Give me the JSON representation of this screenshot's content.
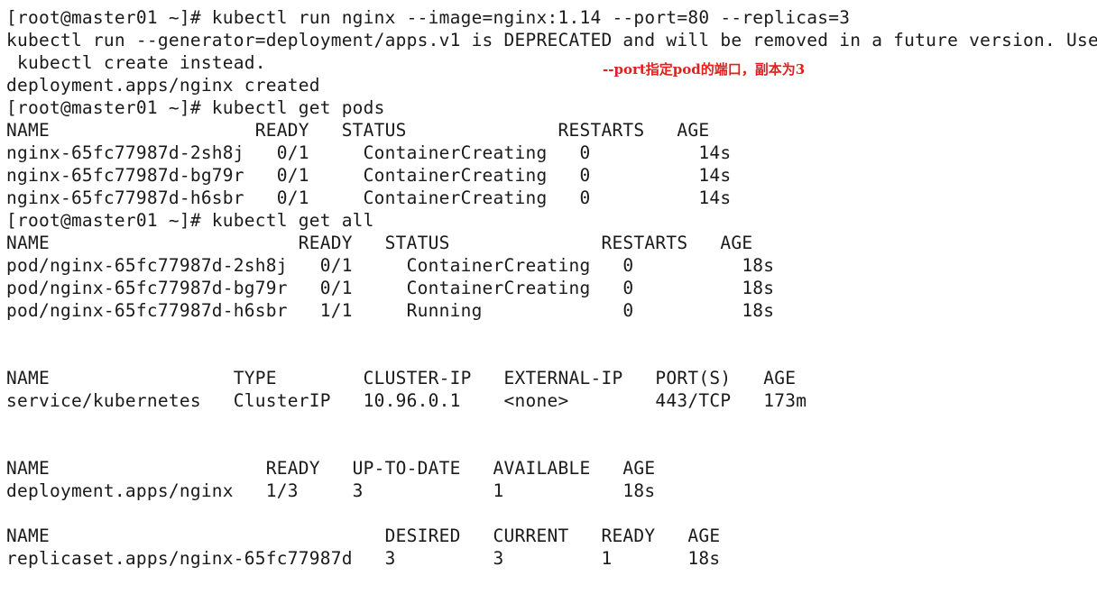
{
  "terminal": {
    "annotation": "--port指定pod的端口，副本为3",
    "lines": [
      "[root@master01 ~]# kubectl run nginx --image=nginx:1.14 --port=80 --replicas=3",
      "kubectl run --generator=deployment/apps.v1 is DEPRECATED and will be removed in a future version. Use",
      " kubectl create instead.",
      "deployment.apps/nginx created",
      "[root@master01 ~]# kubectl get pods",
      "NAME                   READY   STATUS              RESTARTS   AGE",
      "nginx-65fc77987d-2sh8j   0/1     ContainerCreating   0          14s",
      "nginx-65fc77987d-bg79r   0/1     ContainerCreating   0          14s",
      "nginx-65fc77987d-h6sbr   0/1     ContainerCreating   0          14s",
      "[root@master01 ~]# kubectl get all",
      "NAME                       READY   STATUS              RESTARTS   AGE",
      "pod/nginx-65fc77987d-2sh8j   0/1     ContainerCreating   0          18s",
      "pod/nginx-65fc77987d-bg79r   0/1     ContainerCreating   0          18s",
      "pod/nginx-65fc77987d-h6sbr   1/1     Running             0          18s",
      "",
      "",
      "NAME                 TYPE        CLUSTER-IP   EXTERNAL-IP   PORT(S)   AGE",
      "service/kubernetes   ClusterIP   10.96.0.1    <none>        443/TCP   173m",
      "",
      "",
      "NAME                    READY   UP-TO-DATE   AVAILABLE   AGE",
      "deployment.apps/nginx   1/3     3            1           18s",
      "",
      "NAME                               DESIRED   CURRENT   READY   AGE",
      "replicaset.apps/nginx-65fc77987d   3         3         1       18s"
    ]
  }
}
